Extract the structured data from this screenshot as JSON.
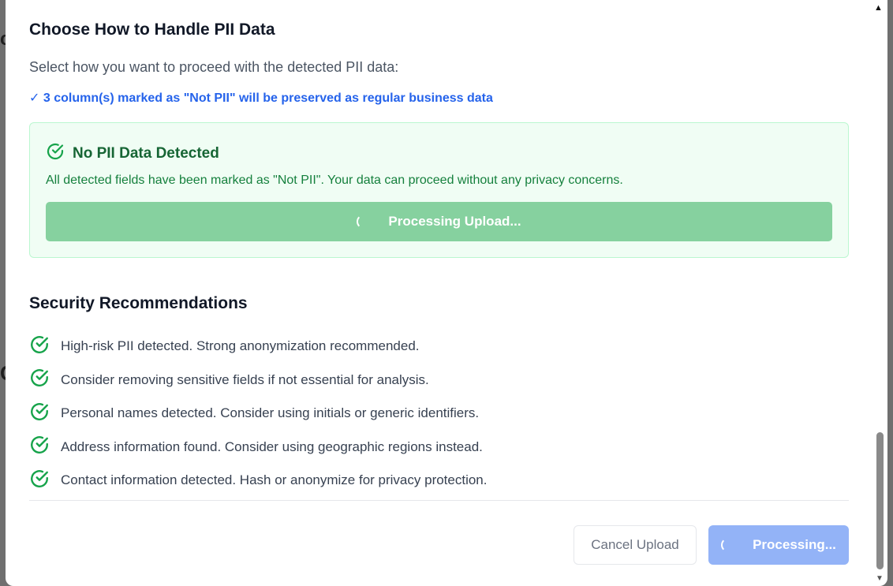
{
  "modal": {
    "title": "Choose How to Handle PII Data",
    "subtitle": "Select how you want to proceed with the detected PII data:",
    "preserved_note": "✓ 3 column(s) marked as \"Not PII\" will be preserved as regular business data"
  },
  "success_panel": {
    "icon": "check-circle-icon",
    "title": "No PII Data Detected",
    "description": "All detected fields have been marked as \"Not PII\". Your data can proceed without any privacy concerns.",
    "button_label": "Processing Upload..."
  },
  "security": {
    "title": "Security Recommendations",
    "items": [
      {
        "icon": "check-circle-icon",
        "text": "High-risk PII detected. Strong anonymization recommended."
      },
      {
        "icon": "check-circle-icon",
        "text": "Consider removing sensitive fields if not essential for analysis."
      },
      {
        "icon": "check-circle-icon",
        "text": "Personal names detected. Consider using initials or generic identifiers."
      },
      {
        "icon": "check-circle-icon",
        "text": "Address information found. Consider using geographic regions instead."
      },
      {
        "icon": "check-circle-icon",
        "text": "Contact information detected. Hash or anonymize for privacy protection."
      }
    ]
  },
  "footer": {
    "cancel_label": "Cancel Upload",
    "processing_label": "Processing..."
  },
  "colors": {
    "primary": "#2563eb",
    "success": "#16a34a",
    "success_button": "#86d19f",
    "processing_button": "#93b3f7"
  }
}
